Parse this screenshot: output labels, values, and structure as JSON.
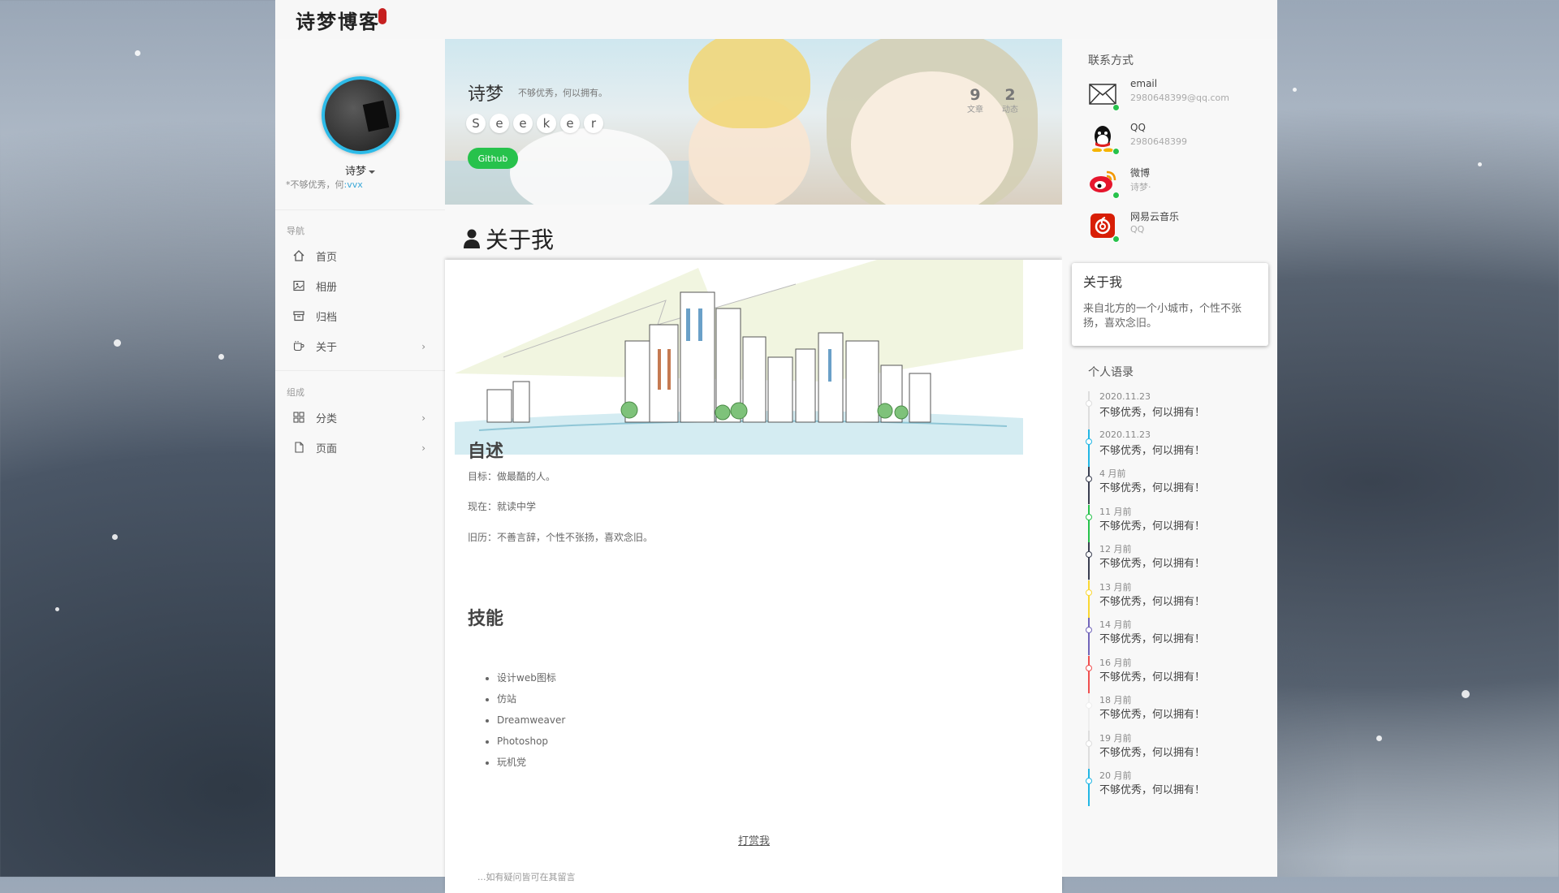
{
  "header": {
    "logo": "诗梦博客"
  },
  "profile": {
    "name": "诗梦",
    "motto_prefix": "*不够优秀，何",
    "motto_link": ":vvx"
  },
  "nav": {
    "section_label": "导航",
    "items": [
      {
        "label": "首页",
        "icon": "home-icon"
      },
      {
        "label": "相册",
        "icon": "image-icon"
      },
      {
        "label": "归档",
        "icon": "archive-icon"
      },
      {
        "label": "关于",
        "icon": "coffee-icon"
      }
    ]
  },
  "compose": {
    "section_label": "组成",
    "items": [
      {
        "label": "分类",
        "icon": "grid-icon"
      },
      {
        "label": "页面",
        "icon": "file-icon"
      }
    ]
  },
  "banner": {
    "name": "诗梦",
    "subtitle": "不够优秀，何以拥有。",
    "letters": [
      "S",
      "e",
      "e",
      "k",
      "e",
      "r"
    ],
    "github_label": "Github",
    "stats": [
      {
        "num": "9",
        "label": "文章"
      },
      {
        "num": "2",
        "label": "动态"
      }
    ]
  },
  "page": {
    "title": "关于我"
  },
  "article": {
    "h_intro": "自述",
    "p1": "目标：做最酷的人。",
    "p2": "现在：就读中学",
    "p3": "旧历：不善言辞，个性不张扬，喜欢念旧。",
    "h_skills": "技能",
    "skills": [
      "设计web图标",
      "仿站",
      "Dreamweaver",
      "Photoshop",
      "玩机党"
    ],
    "reward": "打赏我",
    "trail": "...如有疑问皆可在其留言"
  },
  "contacts": {
    "title": "联系方式",
    "items": [
      {
        "name": "email",
        "value": "2980648399@qq.com",
        "icon": "email-icon"
      },
      {
        "name": "QQ",
        "value": "2980648399",
        "icon": "qq-icon"
      },
      {
        "name": "微博",
        "value": "诗梦·",
        "icon": "weibo-icon"
      },
      {
        "name": "网易云音乐",
        "value": "QQ",
        "icon": "netease-music-icon"
      }
    ]
  },
  "about_widget": {
    "title": "关于我",
    "body": "来自北方的一个小城市，个性不张扬，喜欢念旧。"
  },
  "quotes": {
    "title": "个人语录",
    "items": [
      {
        "date": "2020.11.23",
        "text": "不够优秀，何以拥有！",
        "color": "#dddddd"
      },
      {
        "date": "2020.11.23",
        "text": "不够优秀，何以拥有！",
        "color": "#23b7e5"
      },
      {
        "date": "4 月前",
        "text": "不够优秀，何以拥有！",
        "color": "#3a3f51"
      },
      {
        "date": "11 月前",
        "text": "不够优秀，何以拥有！",
        "color": "#27c24c"
      },
      {
        "date": "12 月前",
        "text": "不够优秀，何以拥有！",
        "color": "#3a3f51"
      },
      {
        "date": "13 月前",
        "text": "不够优秀，何以拥有！",
        "color": "#fad733"
      },
      {
        "date": "14 月前",
        "text": "不够优秀，何以拥有！",
        "color": "#7266ba"
      },
      {
        "date": "16 月前",
        "text": "不够优秀，何以拥有！",
        "color": "#f05050"
      },
      {
        "date": "18 月前",
        "text": "不够优秀，何以拥有！",
        "color": "#eeeeee"
      },
      {
        "date": "19 月前",
        "text": "不够优秀，何以拥有！",
        "color": "#dddddd"
      },
      {
        "date": "20 月前",
        "text": "不够优秀，何以拥有！",
        "color": "#23b7e5"
      }
    ]
  }
}
